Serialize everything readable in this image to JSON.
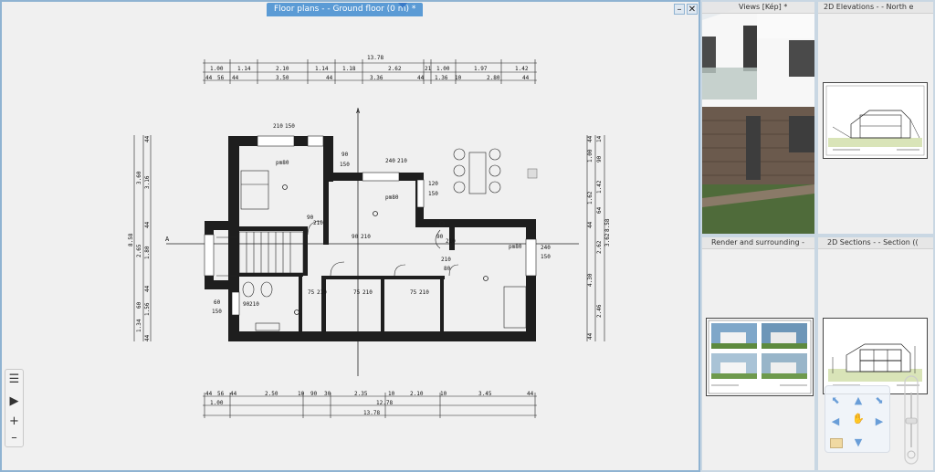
{
  "main_tab": {
    "label": "Floor plans -   - Ground floor (0 m) *"
  },
  "window_controls": {
    "minimize": "–",
    "close": "✕"
  },
  "side_panels": {
    "views": "Views [Kép] *",
    "elevations": "2D Elevations -  - North e",
    "render": "Render and surrounding -",
    "sections": "2D Sections -  - Section (("
  },
  "tools": {
    "list": "☰",
    "play": "▶",
    "plus": "+",
    "minus": "–"
  },
  "dims_top": {
    "total": "13.78",
    "row1": [
      "1.00",
      "1.14",
      "2.10",
      "1.14",
      "1.18",
      "2.62",
      "21",
      "1.00",
      "1.97",
      "1.42"
    ],
    "row2": [
      "44",
      "56",
      "44",
      "3.50",
      "44",
      "3.36",
      "44",
      "1.36",
      "10",
      "2.80",
      "44"
    ]
  },
  "dims_bottom": {
    "row1": [
      "44",
      "56",
      "44",
      "2.50",
      "10",
      "90",
      "30",
      "2.35",
      "10",
      "2.10",
      "10",
      "3.45",
      "44"
    ],
    "row2": [
      "1.00",
      "12.78"
    ],
    "total": "13.78"
  },
  "dims_left": [
    "3.60",
    "3.16",
    "8.58",
    "2.65",
    "1.80",
    "60",
    "1.56",
    "1.34",
    "44",
    "44",
    "44",
    "44"
  ],
  "dims_right": [
    "1.00",
    "1.42",
    "1.62",
    "3.62",
    "2.62",
    "4.30",
    "2.46",
    "8.58",
    "44",
    "44",
    "44",
    "90",
    "64",
    "14"
  ],
  "plan_labels": {
    "section_a": "A",
    "w1": [
      "210",
      "150"
    ],
    "pm1": "pm80",
    "w2": [
      "90",
      "150"
    ],
    "w3": [
      "240",
      "210"
    ],
    "pm2": "pm80",
    "w4": [
      "120",
      "150"
    ],
    "d1": [
      "90",
      "210"
    ],
    "d2": [
      "90",
      "210"
    ],
    "d3": [
      "90",
      "210"
    ],
    "pm3": "pm80",
    "w5": [
      "240",
      "150"
    ],
    "d4": [
      "210",
      "80"
    ],
    "d5": [
      "75",
      "210"
    ],
    "d6": [
      "75",
      "210"
    ],
    "d7": [
      "75",
      "210"
    ],
    "w6": [
      "60",
      "150"
    ],
    "d8": [
      "90",
      "210"
    ]
  }
}
